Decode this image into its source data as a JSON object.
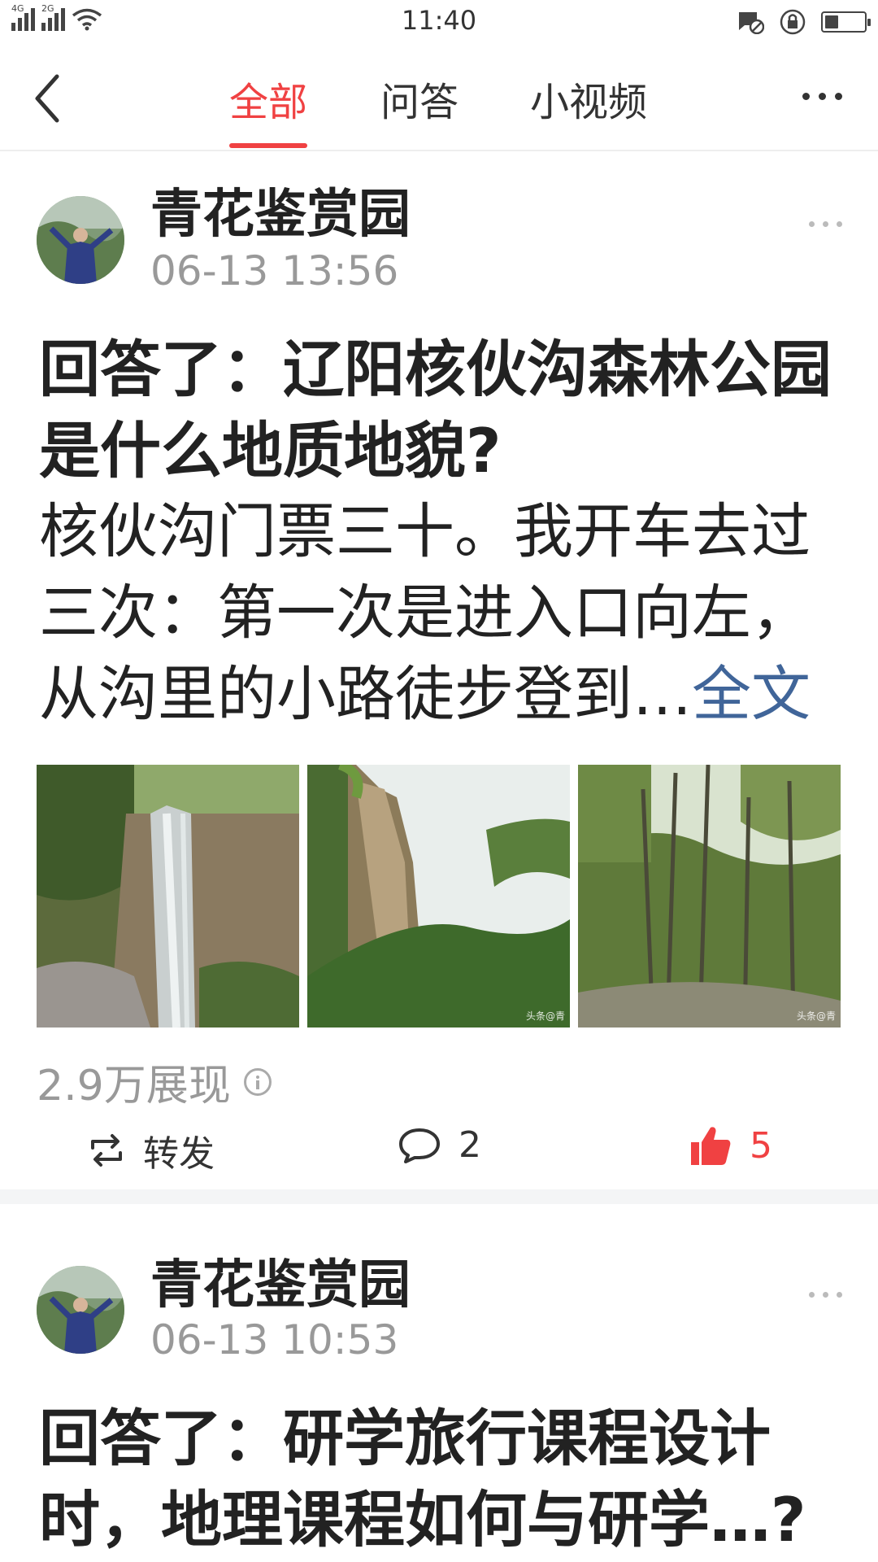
{
  "status_bar": {
    "network_1": "4G",
    "network_2": "2G",
    "time": "11:40",
    "battery_level": 0.35
  },
  "nav": {
    "tabs": [
      {
        "label": "全部",
        "active": true
      },
      {
        "label": "问答",
        "active": false
      },
      {
        "label": "小视频",
        "active": false
      }
    ],
    "accent_color": "#f04142"
  },
  "posts": [
    {
      "author": "青花鉴赏园",
      "time": "06-13 13:56",
      "title_line1": "回答了：辽阳核伙沟森林公园",
      "title_line2": "是什么地质地貌?",
      "body_line1": "核伙沟门票三十。我开车去过",
      "body_line2": "三次：第一次是进入口向左，",
      "body_line3": "从沟里的小路徒步登到…",
      "fulltext_label": "全文",
      "image_watermark": "头条@青",
      "views": "2.9万展现",
      "repost_label": "转发",
      "comments": "2",
      "likes": "5"
    },
    {
      "author": "青花鉴赏园",
      "time": "06-13 10:53",
      "title_line1": "回答了：研学旅行课程设计",
      "title_line2": "时，地理课程如何与研学…?"
    }
  ]
}
